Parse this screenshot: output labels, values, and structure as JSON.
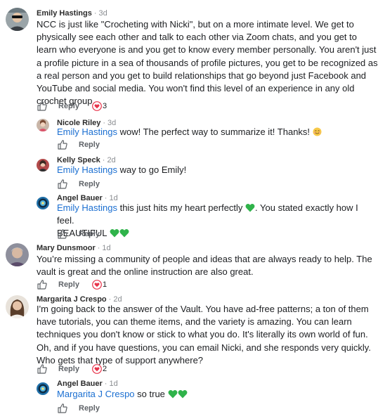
{
  "comments": [
    {
      "author": "Emily Hastings",
      "time": "3d",
      "text": "NCC is just like \"Crocheting with Nicki\", but on a more intimate level. We get to physically see each other and talk to each other via Zoom chats, and you get to learn who everyone is and you get to know every member personally. You aren't just a profile picture in a sea of thousands of profile pictures, you get to be recognized as a real person and you get to build relationships that go beyond just Facebook and YouTube and social media. You won't find this level of an experience in any old crochet group.",
      "reply_label": "Reply",
      "reaction_count": "3"
    },
    {
      "author": "Nicole Riley",
      "time": "3d",
      "mention": "Emily Hastings",
      "text": " wow! The perfect way to summarize it! Thanks!",
      "reply_label": "Reply"
    },
    {
      "author": "Kelly Speck",
      "time": "2d",
      "mention": "Emily Hastings",
      "text": " way to go Emily!",
      "reply_label": "Reply"
    },
    {
      "author": "Angel Bauer",
      "time": "1d",
      "mention": "Emily Hastings",
      "text_a": " this just hits my heart perfectly ",
      "text_b": ". You stated exactly how I feel.",
      "text_c": "BEAUTIFUL ",
      "reply_label": "Reply"
    },
    {
      "author": "Mary Dunsmoor",
      "time": "1d",
      "text": "You’re missing a community of people and ideas that are always ready to help. The vault is great and the online instruction are also great.",
      "reply_label": "Reply",
      "reaction_count": "1"
    },
    {
      "author": "Margarita J Crespo",
      "time": "2d",
      "text": "I'm going back to the answer of the Vault. You have ad-free patterns; a ton of them have tutorials, you can theme items, and the variety is amazing. You can learn techniques you don't know or stick to what you do. It's literally its own world of fun. Oh, and if you have questions, you can email Nicki, and she responds very quickly. Who gets that type of support anywhere?",
      "reply_label": "Reply",
      "reaction_count": "2"
    },
    {
      "author": "Angel Bauer",
      "time": "1d",
      "mention": "Margarita J Crespo",
      "text": " so true ",
      "reply_label": "Reply"
    }
  ],
  "separator": "·",
  "icons": {
    "like": "thumbs-up-icon",
    "heart_reaction": "heart-reaction-icon",
    "smile": "smiling-face-emoji",
    "green_heart": "green-heart-emoji"
  },
  "colors": {
    "mention": "#1b6fd1",
    "reaction_heart": "#e8334a",
    "green_heart": "#2fb34a",
    "meta_gray": "#8a8d91"
  }
}
